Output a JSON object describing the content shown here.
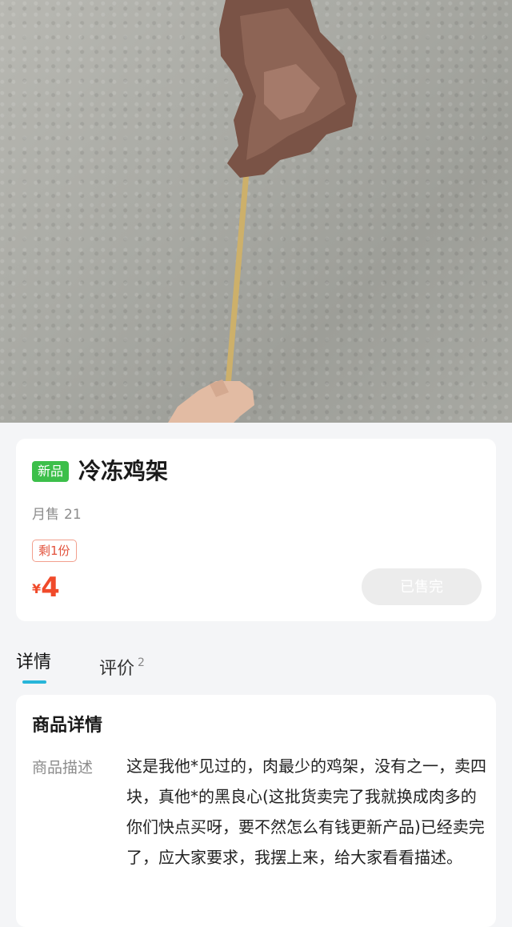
{
  "product": {
    "badge": "新品",
    "title": "冷冻鸡架",
    "monthly_label": "月售",
    "monthly_count": "21",
    "stock": "剩1份",
    "currency": "¥",
    "price": "4",
    "sold_out": "已售完"
  },
  "tabs": [
    {
      "label": "详情",
      "count": ""
    },
    {
      "label": "评价",
      "count": "2"
    }
  ],
  "detail": {
    "title": "商品详情",
    "label": "商品描述",
    "description": "这是我他*见过的，肉最少的鸡架，没有之一，卖四块，真他*的黑良心(这批货卖完了我就换成肉多的你们快点买呀，要不然怎么有钱更新产品)已经卖完了，应大家要求，我摆上来，给大家看看描述。"
  },
  "colors": {
    "accent": "#27b5d9",
    "price": "#f04a2a",
    "new_badge": "#3cbf4a"
  }
}
